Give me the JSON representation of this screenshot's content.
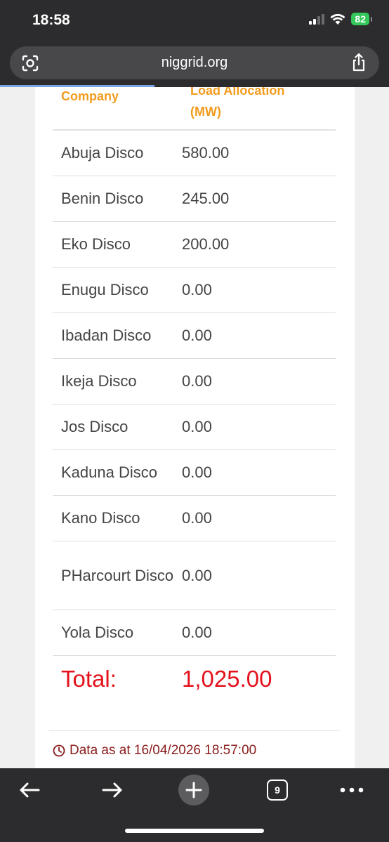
{
  "status_bar": {
    "time": "18:58",
    "battery": "82"
  },
  "browser": {
    "url": "niggrid.org",
    "tab_count": "9"
  },
  "table": {
    "headers": {
      "company": "Company",
      "load_line1": "Load Allocation",
      "load_line2": "(MW)"
    },
    "rows": [
      {
        "company": "Abuja Disco",
        "value": "580.00"
      },
      {
        "company": "Benin Disco",
        "value": "245.00"
      },
      {
        "company": "Eko Disco",
        "value": "200.00"
      },
      {
        "company": "Enugu Disco",
        "value": "0.00"
      },
      {
        "company": "Ibadan Disco",
        "value": "0.00"
      },
      {
        "company": "Ikeja Disco",
        "value": "0.00"
      },
      {
        "company": "Jos Disco",
        "value": "0.00"
      },
      {
        "company": "Kaduna Disco",
        "value": "0.00"
      },
      {
        "company": "Kano Disco",
        "value": "0.00"
      },
      {
        "company": "PHarcourt Disco",
        "value": "0.00"
      },
      {
        "company": "Yola Disco",
        "value": "0.00"
      }
    ],
    "total_label": "Total:",
    "total_value": "1,025.00"
  },
  "footer": {
    "timestamp": "Data as at 16/04/2026 18:57:00"
  },
  "colors": {
    "header": "#f29c1f",
    "total": "#e3121c",
    "timestamp": "#8b1c1c"
  }
}
